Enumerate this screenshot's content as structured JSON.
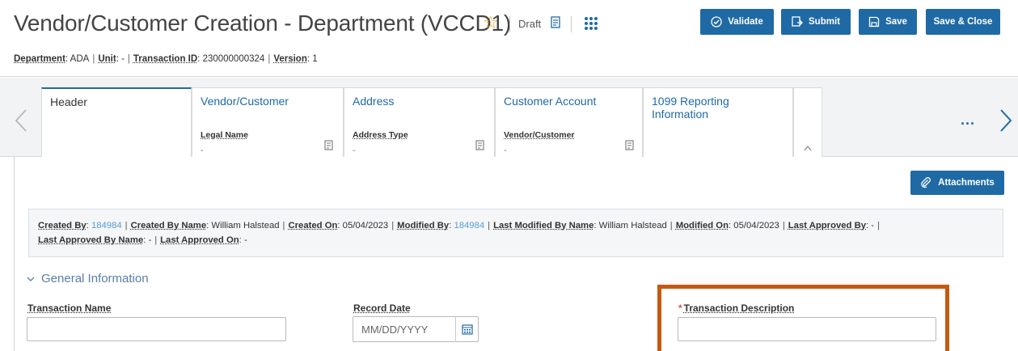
{
  "header": {
    "title": "Vendor/Customer Creation - Department (VCCD1)",
    "status": "Draft",
    "meta": [
      {
        "key": "Department",
        "value": "ADA"
      },
      {
        "key": "Unit",
        "value": "-"
      },
      {
        "key": "Transaction ID",
        "value": "230000000324"
      },
      {
        "key": "Version",
        "value": "1"
      }
    ]
  },
  "toolbar": {
    "validate_label": "Validate",
    "submit_label": "Submit",
    "save_label": "Save",
    "save_close_label": "Save & Close",
    "accent": "#1f6aa5"
  },
  "tabs": [
    {
      "title": "Header",
      "field_label": "",
      "field_value": ""
    },
    {
      "title": "Vendor/Customer",
      "field_label": "Legal Name",
      "field_value": "-"
    },
    {
      "title": "Address",
      "field_label": "Address Type",
      "field_value": "-"
    },
    {
      "title": "Customer Account",
      "field_label": "Vendor/Customer",
      "field_value": "-"
    },
    {
      "title": "1099 Reporting Information",
      "field_label": "",
      "field_value": ""
    }
  ],
  "more_label": "...",
  "attachments_label": "Attachments",
  "audit": {
    "created_by_label": "Created By",
    "created_by": "184984",
    "created_by_name_label": "Created By Name",
    "created_by_name": "William Halstead",
    "created_on_label": "Created On",
    "created_on": "05/04/2023",
    "modified_by_label": "Modified By",
    "modified_by": "184984",
    "last_modified_by_name_label": "Last Modified By Name",
    "last_modified_by_name": "William Halstead",
    "modified_on_label": "Modified On",
    "modified_on": "05/04/2023",
    "last_approved_by_label": "Last Approved By",
    "last_approved_by": "-",
    "last_approved_by_name_label": "Last Approved By Name",
    "last_approved_by_name": "-",
    "last_approved_on_label": "Last Approved On",
    "last_approved_on": "-"
  },
  "general": {
    "section_title": "General Information",
    "transaction_name_label": "Transaction Name",
    "transaction_name_value": "",
    "record_date_label": "Record Date",
    "record_date_placeholder": "MM/DD/YYYY",
    "transaction_description_label": "Transaction Description",
    "transaction_description_value": "",
    "required_marker": "*"
  },
  "highlight_color": "#c65911"
}
